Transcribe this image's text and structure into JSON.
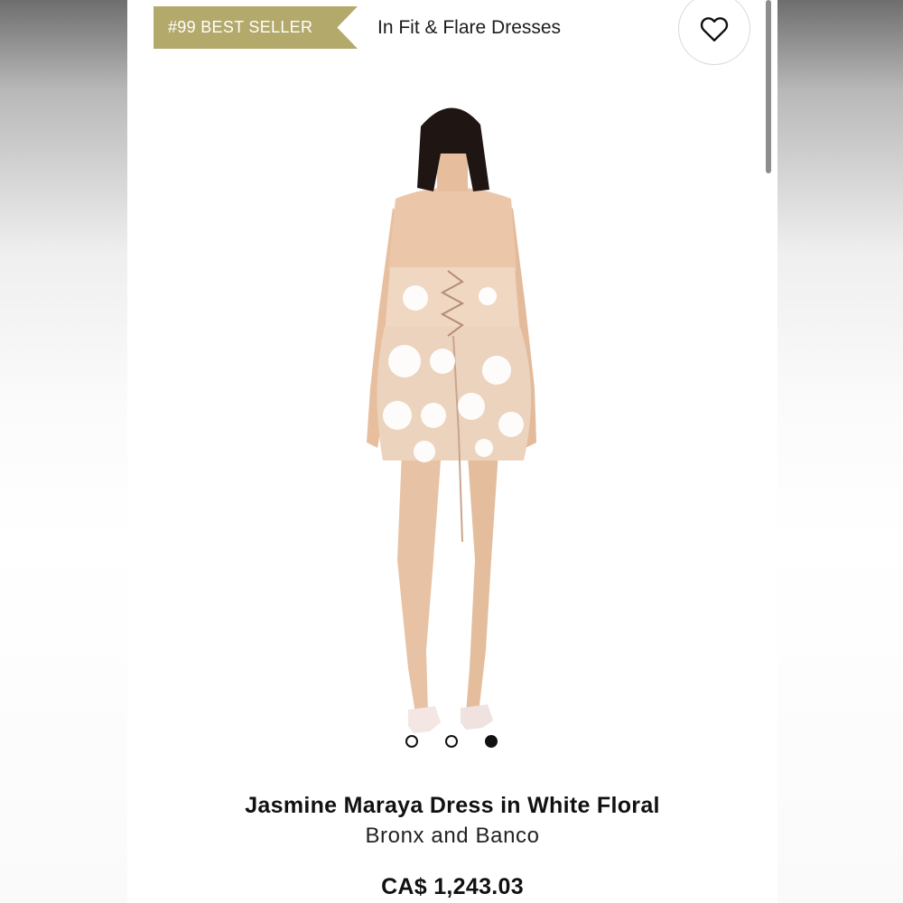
{
  "badge": {
    "label": "#99 BEST SELLER",
    "color": "#b3a96b"
  },
  "category": {
    "label": "In Fit & Flare Dresses"
  },
  "wishlist": {
    "icon": "heart-icon"
  },
  "gallery": {
    "image": "model-back-view-floral-mini-dress",
    "slide_count": 3,
    "active_slide": 3
  },
  "product": {
    "title": "Jasmine Maraya Dress in White Floral",
    "brand": "Bronx and Banco",
    "price": "CA$ 1,243.03"
  }
}
